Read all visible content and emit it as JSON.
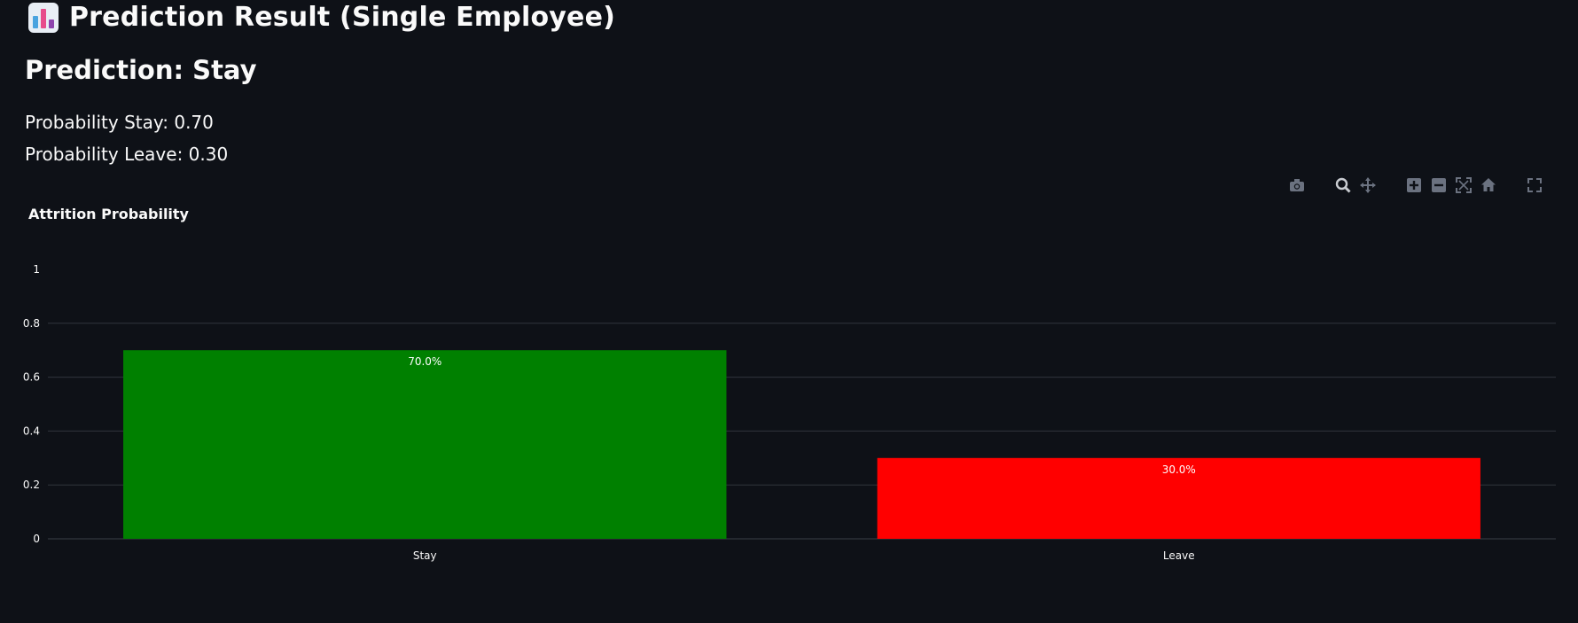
{
  "header": {
    "title": "Prediction Result (Single Employee)",
    "icon": "bar-chart-emoji-icon"
  },
  "result": {
    "prediction": "Prediction: Stay",
    "prob_stay": "Probability Stay: 0.70",
    "prob_leave": "Probability Leave: 0.30"
  },
  "modebar": {
    "icons": [
      "camera-icon",
      "zoom-icon",
      "pan-icon",
      "zoom-in-icon",
      "zoom-out-icon",
      "autoscale-icon",
      "reset-axes-icon",
      "fullscreen-icon"
    ]
  },
  "chart_data": {
    "type": "bar",
    "title": "Attrition Probability",
    "categories": [
      "Stay",
      "Leave"
    ],
    "values": [
      0.7,
      0.3
    ],
    "data_labels": [
      "70.0%",
      "30.0%"
    ],
    "colors": [
      "#008000",
      "#ff0000"
    ],
    "ylim": [
      0,
      1
    ],
    "yticks": [
      0,
      0.2,
      0.4,
      0.6,
      0.8,
      1
    ],
    "ytick_labels": [
      "0",
      "0.2",
      "0.4",
      "0.6",
      "0.8",
      "1"
    ],
    "grid": true,
    "xlabel": "",
    "ylabel": ""
  }
}
